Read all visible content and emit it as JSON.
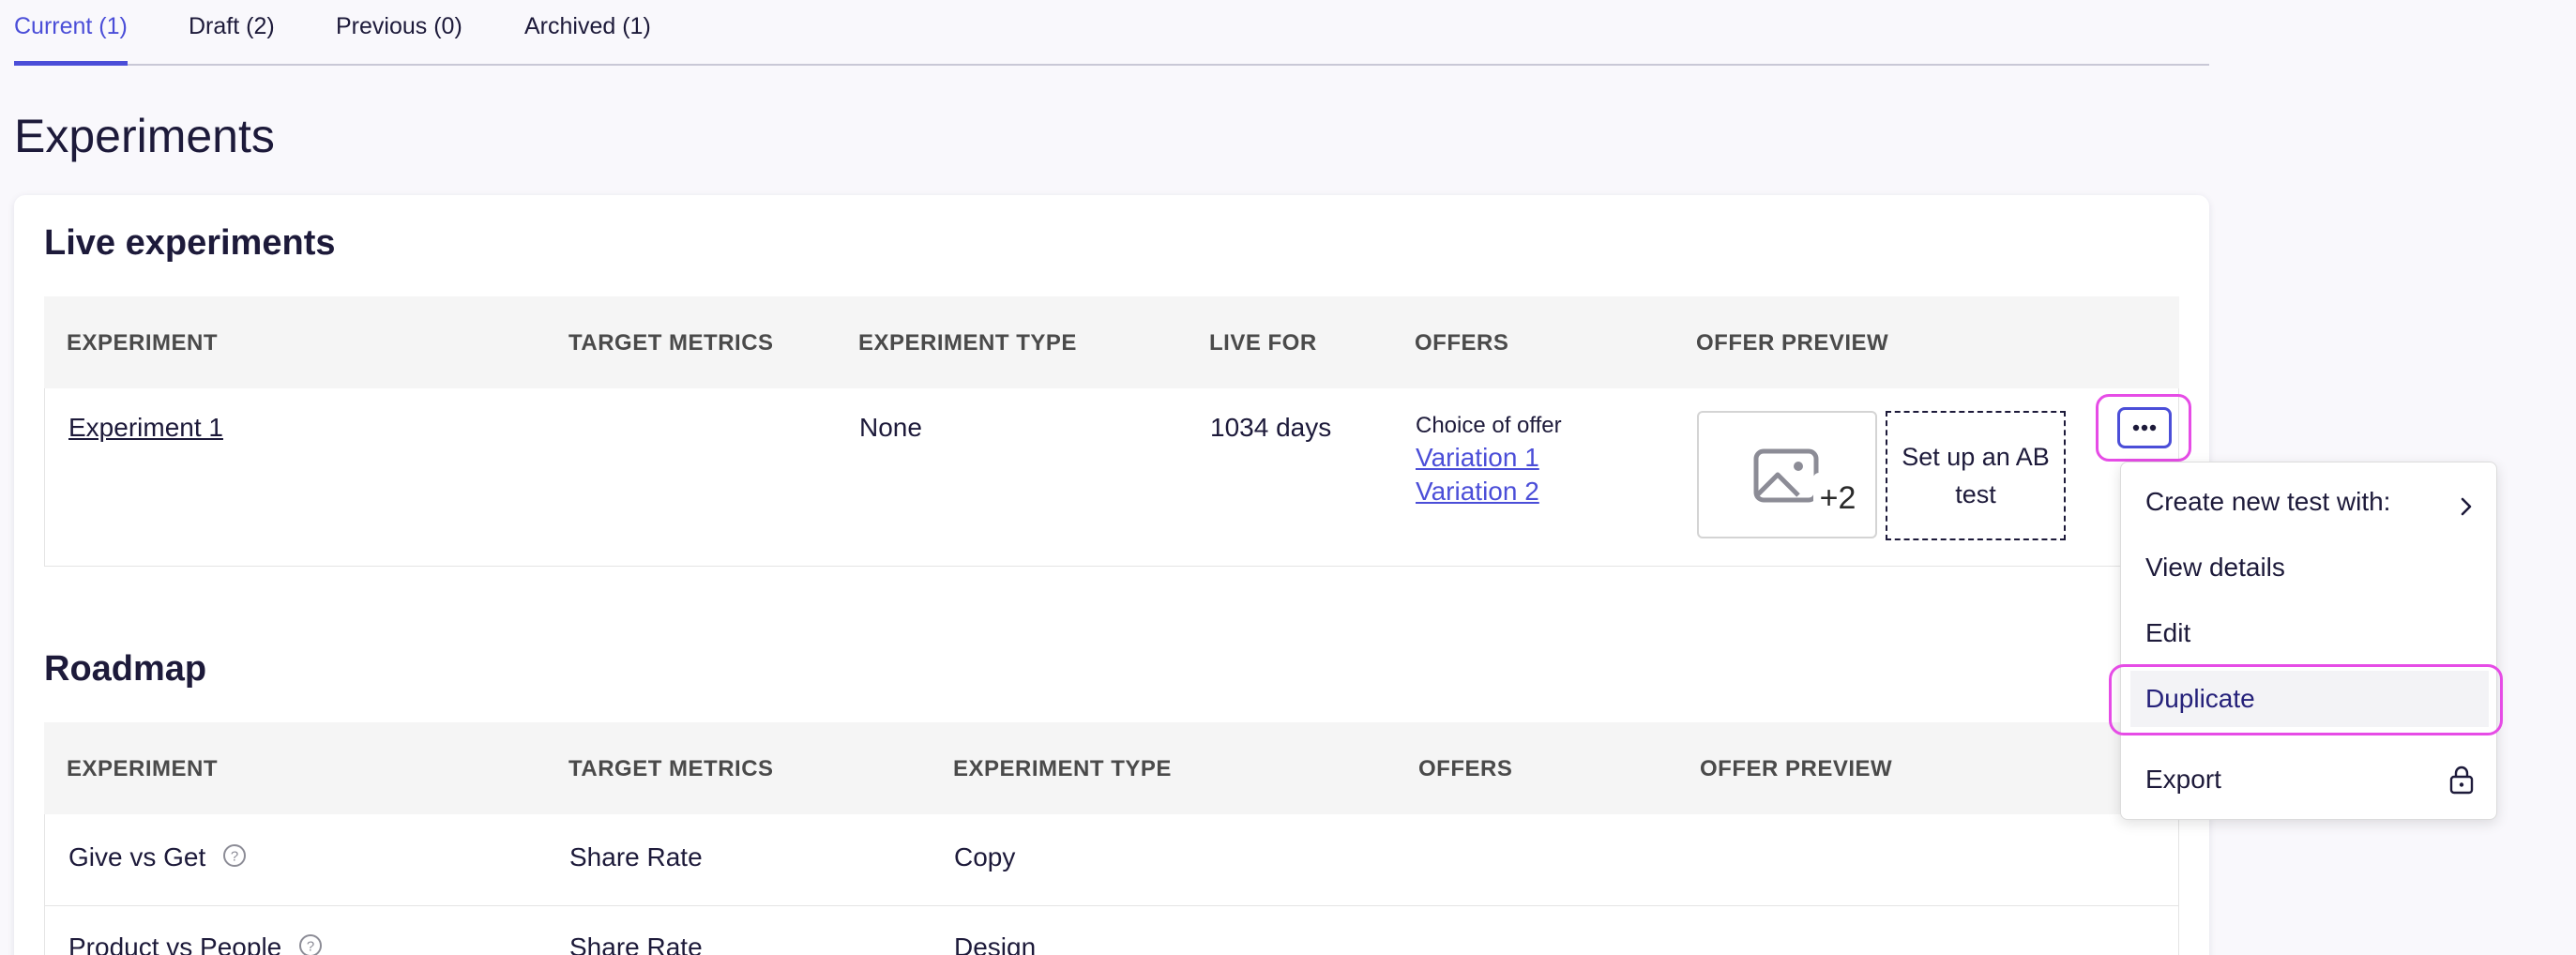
{
  "tabs": [
    {
      "label": "Current (1)",
      "active": true
    },
    {
      "label": "Draft (2)",
      "active": false
    },
    {
      "label": "Previous (0)",
      "active": false
    },
    {
      "label": "Archived (1)",
      "active": false
    }
  ],
  "page_title": "Experiments",
  "live": {
    "title": "Live experiments",
    "columns": [
      "EXPERIMENT",
      "TARGET METRICS",
      "EXPERIMENT TYPE",
      "LIVE FOR",
      "OFFERS",
      "OFFER PREVIEW"
    ],
    "rows": [
      {
        "experiment": "Experiment 1",
        "target_metrics": "",
        "experiment_type": "None",
        "live_for": "1034 days",
        "offer_label": "Choice of offer",
        "offers": [
          "Variation 1",
          "Variation 2"
        ],
        "preview_extra": "+2",
        "ab_test": "Set up an AB test",
        "preview_icon": "image-placeholder-icon",
        "more_icon": "ellipsis-icon"
      }
    ]
  },
  "roadmap": {
    "title": "Roadmap",
    "columns": [
      "EXPERIMENT",
      "TARGET METRICS",
      "EXPERIMENT TYPE",
      "OFFERS",
      "OFFER PREVIEW"
    ],
    "rows": [
      {
        "experiment": "Give vs Get",
        "target_metrics": "Share Rate",
        "experiment_type": "Copy",
        "help_icon": "question-circle-icon"
      },
      {
        "experiment": "Product vs People",
        "target_metrics": "Share Rate",
        "experiment_type": "Design",
        "help_icon": "question-circle-icon"
      }
    ]
  },
  "menu": {
    "items": [
      {
        "label": "Create new test with:",
        "icon": "chevron-right-icon"
      },
      {
        "label": "View details"
      },
      {
        "label": "Edit"
      },
      {
        "label": "Duplicate",
        "selected": true
      },
      {
        "label": "Export",
        "icon": "lock-icon"
      }
    ]
  },
  "colors": {
    "accent": "#4b4ed8",
    "highlight": "#e64ce6",
    "text": "#1d1a3a",
    "header_bg": "#f5f5f5"
  }
}
